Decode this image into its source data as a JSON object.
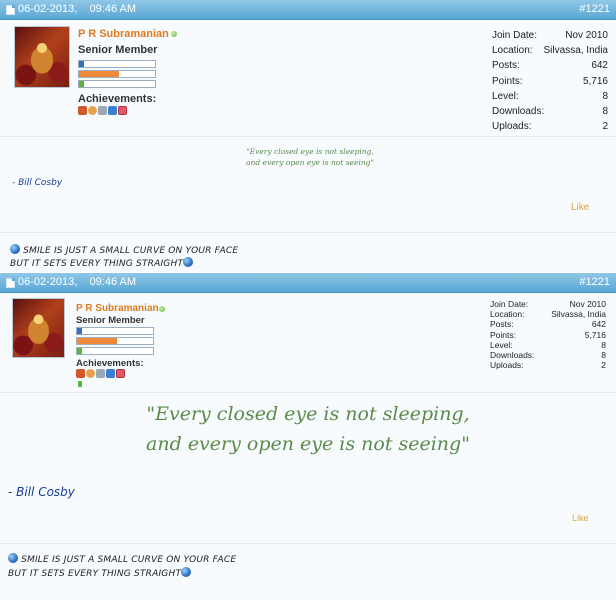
{
  "posts": [
    {
      "date": "06-02-2013,",
      "time": "09:46 AM",
      "post_number": "#1221",
      "username": "P R Subramanian",
      "user_title": "Senior Member",
      "achievements_label": "Achievements:",
      "reputation_levels": {
        "bar1": 0.06,
        "bar2": 0.52,
        "bar3": 0.06
      },
      "stats": [
        {
          "label": "Join Date:",
          "value": "Nov 2010"
        },
        {
          "label": "Location:",
          "value": "Silvassa, India"
        },
        {
          "label": "Posts:",
          "value": "642"
        },
        {
          "label": "Points:",
          "value": "5,716"
        },
        {
          "label": "Level:",
          "value": "8"
        },
        {
          "label": "Downloads:",
          "value": "8"
        },
        {
          "label": "Uploads:",
          "value": "2"
        }
      ],
      "quote_line1": "\"Every closed eye is not sleeping,",
      "quote_line2": "and every open eye is not seeing\"",
      "author": "- Bill Cosby",
      "like_label": "Like",
      "signature_line1": "SMILE IS JUST A SMALL CURVE ON YOUR FACE",
      "signature_line2": "BUT IT SETS EVERY THING STRAIGHT"
    },
    {
      "date": "06-02-2013,",
      "time": "09:46 AM",
      "post_number": "#1221",
      "username": "P R Subramanian",
      "user_title": "Senior Member",
      "achievements_label": "Achievements:",
      "reputation_levels": {
        "bar1": 0.06,
        "bar2": 0.52,
        "bar3": 0.06
      },
      "stats": [
        {
          "label": "Join Date:",
          "value": "Nov 2010"
        },
        {
          "label": "Location:",
          "value": "Silvassa, India"
        },
        {
          "label": "Posts:",
          "value": "642"
        },
        {
          "label": "Points:",
          "value": "5,716"
        },
        {
          "label": "Level:",
          "value": "8"
        },
        {
          "label": "Downloads:",
          "value": "8"
        },
        {
          "label": "Uploads:",
          "value": "2"
        }
      ],
      "quote_line1": "\"Every closed eye is not sleeping,",
      "quote_line2": "and every open eye is not seeing\"",
      "author": "- Bill Cosby",
      "like_label": "Like",
      "signature_line1": "SMILE IS JUST A SMALL CURVE ON YOUR FACE",
      "signature_line2": "BUT IT SETS EVERY THING STRAIGHT"
    }
  ],
  "colors": {
    "header_bar": "#5aa7d6",
    "username": "#e07a1f",
    "quote": "#5b8a4a",
    "author": "#1a3a9a",
    "like": "#e0a040",
    "online": "#5db33a"
  }
}
